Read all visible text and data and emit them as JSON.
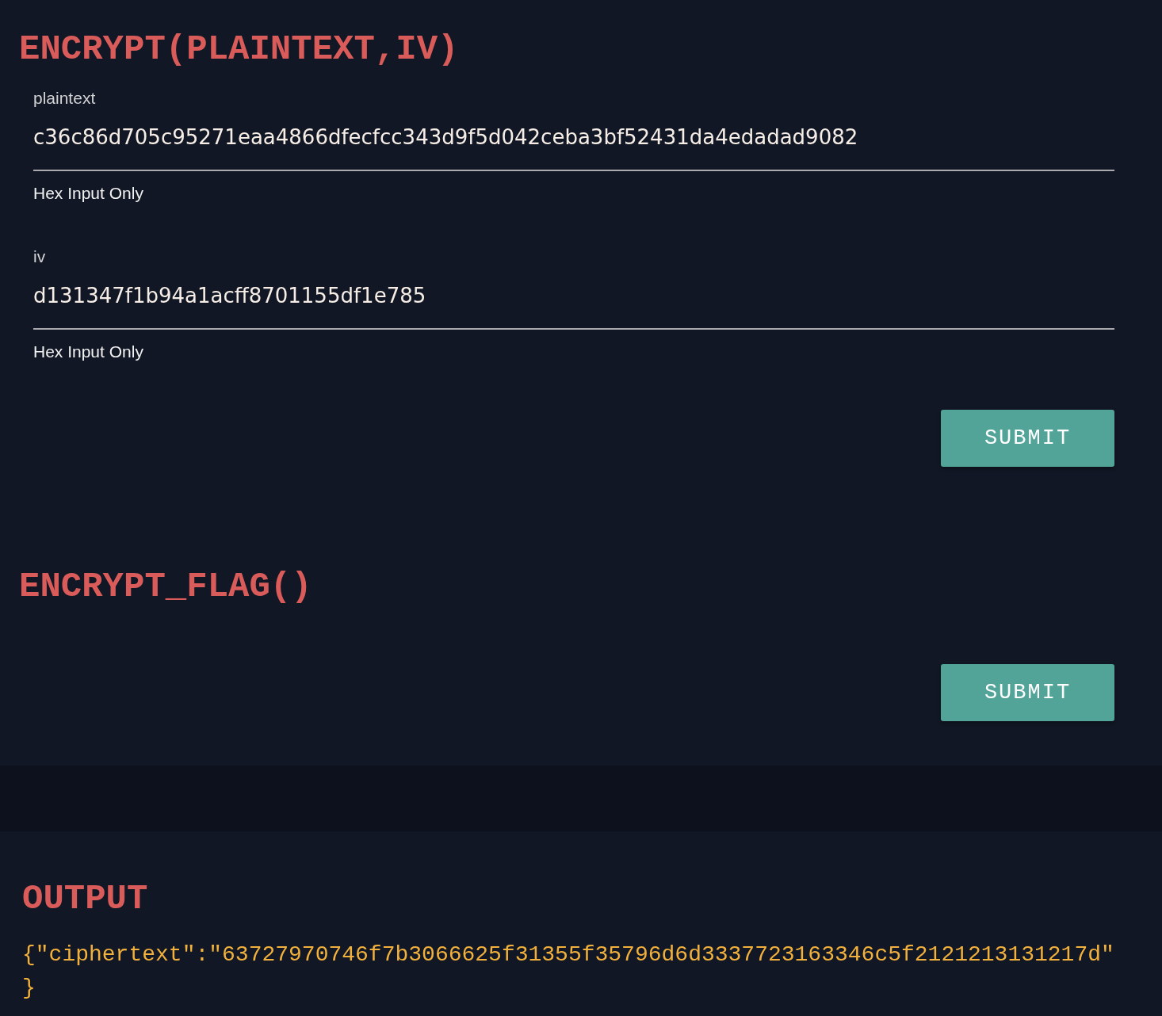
{
  "sections": [
    {
      "title": "ENCRYPT(PLAINTEXT,IV)",
      "fields": [
        {
          "label": "plaintext",
          "value": "c36c86d705c95271eaa4866dfecfcc343d9f5d042ceba3bf52431da4edadad9082",
          "helper": "Hex Input Only"
        },
        {
          "label": "iv",
          "value": "d131347f1b94a1acff8701155df1e785",
          "helper": "Hex Input Only"
        }
      ],
      "button": "SUBMIT"
    },
    {
      "title": "ENCRYPT_FLAG()",
      "button": "SUBMIT"
    }
  ],
  "output": {
    "title": "OUTPUT",
    "lines": [
      "{\"ciphertext\":\"63727970746f7b3066625f31355f35796d6d3337723163346c5f2121213131217d\"",
      "}"
    ]
  }
}
